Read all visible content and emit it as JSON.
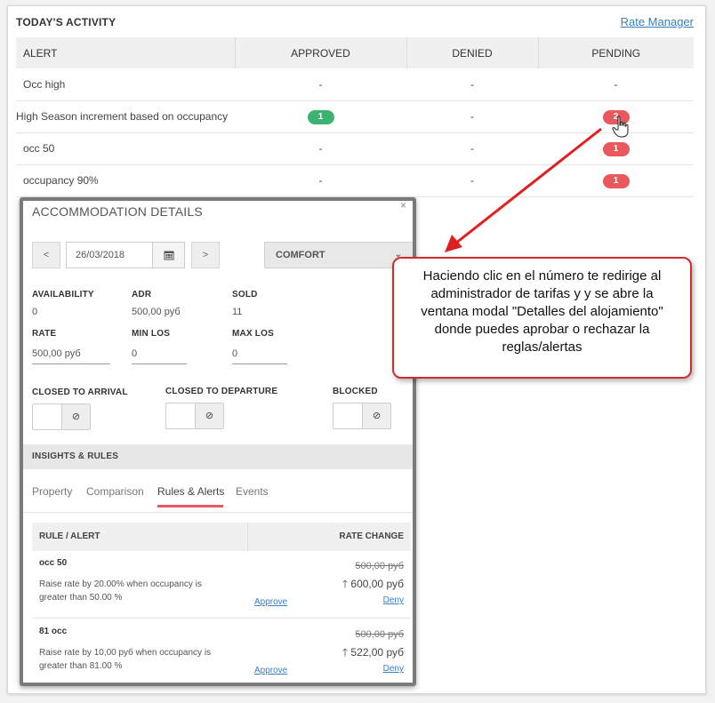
{
  "activity": {
    "title": "TODAY'S ACTIVITY",
    "rate_manager_link": "Rate Manager",
    "columns": [
      "ALERT",
      "APPROVED",
      "DENIED",
      "PENDING"
    ],
    "rows": [
      {
        "alert": "Occ high",
        "approved": "-",
        "denied": "-",
        "pending": "-"
      },
      {
        "alert": "High Season increment based on occupancy",
        "approved": "1",
        "denied": "-",
        "pending": "2"
      },
      {
        "alert": "occ 50",
        "approved": "-",
        "denied": "-",
        "pending": "1"
      },
      {
        "alert": "occupancy 90%",
        "approved": "-",
        "denied": "-",
        "pending": "1"
      }
    ]
  },
  "modal": {
    "title": "ACCOMMODATION DETAILS",
    "close": "×",
    "prev": "<",
    "next": ">",
    "date": "26/03/2018",
    "room_type": "COMFORT",
    "availability_label": "AVAILABILITY",
    "availability": "0",
    "adr_label": "ADR",
    "adr": "500,00 руб",
    "sold_label": "SOLD",
    "sold": "11",
    "rate_label": "RATE",
    "rate": "500,00 руб",
    "min_los_label": "MIN LOS",
    "min_los": "0",
    "max_los_label": "MAX LOS",
    "max_los": "0",
    "closed_arrival_label": "CLOSED TO ARRIVAL",
    "closed_departure_label": "CLOSED TO DEPARTURE",
    "blocked_label": "BLOCKED",
    "toggle_icon": "⊘",
    "insights_title": "INSIGHTS & RULES",
    "tabs": [
      "Property",
      "Comparison",
      "Rules & Alerts",
      "Events"
    ],
    "active_tab": "Rules & Alerts",
    "rules_header": {
      "rule": "RULE / ALERT",
      "rate_change": "RATE CHANGE"
    },
    "rules": [
      {
        "name": "occ 50",
        "description": "Raise rate by 20.00% when occupancy is greater than 50.00 %",
        "old_rate": "500,00 руб",
        "new_rate": "600,00 руб",
        "approve": "Approve",
        "deny": "Deny"
      },
      {
        "name": "81 occ",
        "description": "Raise rate by 10,00 руб when occupancy is greater than 81.00 %",
        "old_rate": "500,00 руб",
        "new_rate": "522,00 руб",
        "approve": "Approve",
        "deny": "Deny"
      }
    ]
  },
  "callout": {
    "text": "Haciendo clic en el número te redirige al administrador de tarifas y y se abre la ventana modal \"Detalles del alojamiento\" donde puedes aprobar o rechazar la reglas/alertas"
  },
  "colors": {
    "approved_badge": "#3cb371",
    "pending_badge": "#e8585c",
    "link": "#3a7fc1",
    "callout_border": "#d62b2b",
    "active_tab_underline": "#e8585c"
  }
}
